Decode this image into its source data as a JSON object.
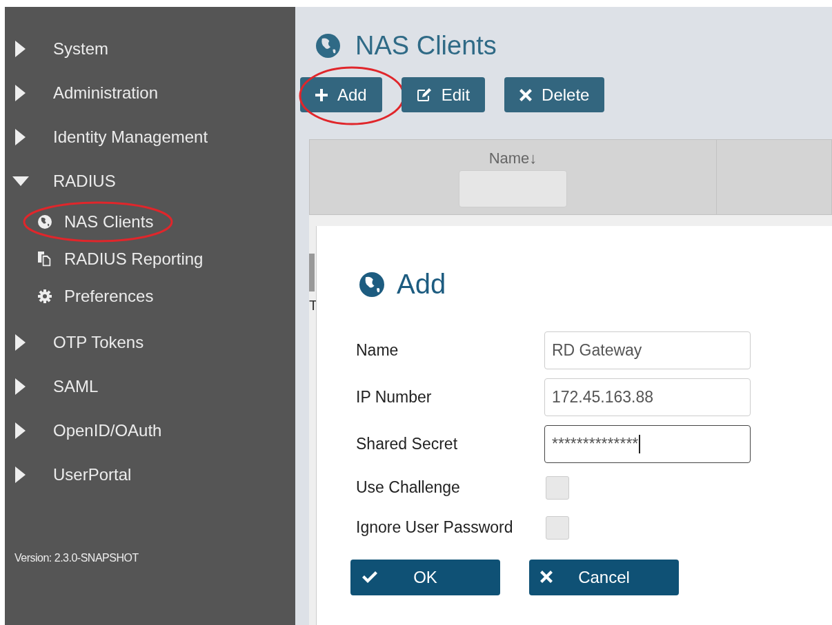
{
  "sidebar": {
    "items": [
      {
        "label": "System",
        "expanded": false
      },
      {
        "label": "Administration",
        "expanded": false
      },
      {
        "label": "Identity Management",
        "expanded": false
      },
      {
        "label": "RADIUS",
        "expanded": true,
        "children": [
          {
            "label": "NAS Clients",
            "circled": true
          },
          {
            "label": "RADIUS Reporting",
            "circled": false
          },
          {
            "label": "Preferences",
            "circled": false
          }
        ]
      },
      {
        "label": "OTP Tokens",
        "expanded": false
      },
      {
        "label": "SAML",
        "expanded": false
      },
      {
        "label": "OpenID/OAuth",
        "expanded": false
      },
      {
        "label": "UserPortal",
        "expanded": false
      }
    ],
    "version": "Version: 2.3.0-SNAPSHOT"
  },
  "page": {
    "title": "NAS Clients",
    "toolbar": [
      {
        "label": "Add",
        "circled": true
      },
      {
        "label": "Edit",
        "circled": false
      },
      {
        "label": "Delete",
        "circled": false
      }
    ]
  },
  "table": {
    "columns": [
      {
        "label": "Name",
        "sort_indicator": "↓"
      }
    ],
    "cut_text": "T"
  },
  "dialog": {
    "title": "Add",
    "fields": [
      {
        "kind": "text",
        "label": "Name",
        "value": "RD Gateway",
        "focused": false
      },
      {
        "kind": "text",
        "label": "IP Number",
        "value": "172.45.163.88",
        "focused": false
      },
      {
        "kind": "text",
        "label": "Shared Secret",
        "value": "**************",
        "focused": true
      },
      {
        "kind": "checkbox",
        "label": "Use Challenge",
        "checked": false
      },
      {
        "kind": "checkbox",
        "label": "Ignore User Password",
        "checked": false
      }
    ],
    "buttons": [
      {
        "label": "OK"
      },
      {
        "label": "Cancel"
      }
    ]
  }
}
